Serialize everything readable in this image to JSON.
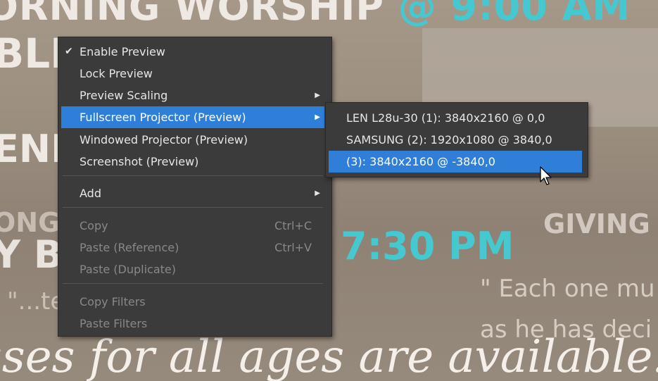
{
  "background": {
    "title_prefix": "ORNING WORSHIP ",
    "title_time": "@ 9:00 AM",
    "line2": "BLE                    LLOW",
    "line3": "ENI",
    "time2": "7:30 PM",
    "giving": "GIVING",
    "faint1": "ONG                          GING",
    "faint2": "Y B",
    "quote1": "\"...te                               ing",
    "quote2": "\" Each one mu",
    "quote3": "as he has deci",
    "script": "sses for all ages are available!"
  },
  "context_menu": {
    "items": [
      {
        "label": "Enable Preview",
        "checked": true
      },
      {
        "label": "Lock Preview"
      },
      {
        "label": "Preview Scaling",
        "submenu": true
      },
      {
        "label": "Fullscreen Projector (Preview)",
        "submenu": true,
        "active": true
      },
      {
        "label": "Windowed Projector (Preview)"
      },
      {
        "label": "Screenshot (Preview)"
      },
      {
        "label": "Add",
        "submenu": true
      },
      {
        "label": "Copy",
        "shortcut": "Ctrl+C",
        "disabled": true
      },
      {
        "label": "Paste (Reference)",
        "shortcut": "Ctrl+V",
        "disabled": true
      },
      {
        "label": "Paste (Duplicate)",
        "disabled": true
      },
      {
        "label": "Copy Filters",
        "disabled": true
      },
      {
        "label": "Paste Filters",
        "disabled": true
      }
    ]
  },
  "projector_submenu": {
    "items": [
      {
        "label": "LEN L28u-30 (1): 3840x2160 @ 0,0"
      },
      {
        "label": "SAMSUNG (2): 1920x1080 @ 3840,0"
      },
      {
        "label": "(3): 3840x2160 @ -3840,0",
        "active": true
      }
    ]
  },
  "icons": {
    "check": "checkmark-icon",
    "submenu_arrow": "submenu-arrow-icon",
    "cursor": "mouse-pointer-icon"
  },
  "colors": {
    "menu_bg": "#3b3b3b",
    "highlight": "#2f7fd8",
    "disabled_text": "#888888",
    "accent_text": "#45c8cf"
  }
}
